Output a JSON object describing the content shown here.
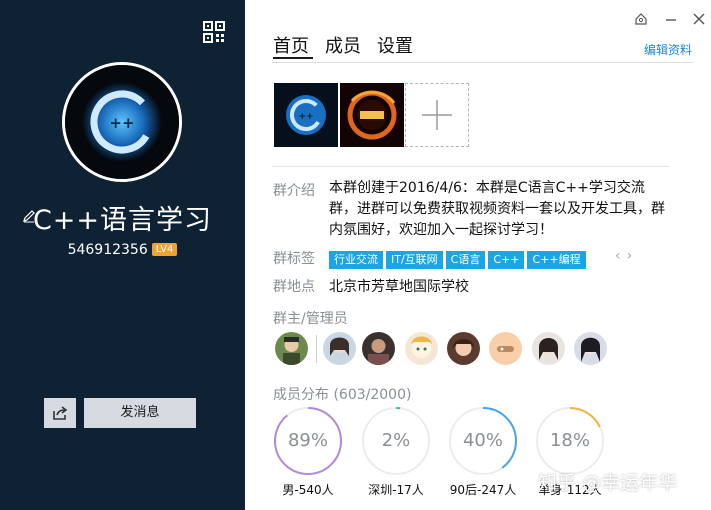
{
  "group": {
    "name": "C++语言学习",
    "id": "546912356",
    "level": "LV4"
  },
  "left_actions": {
    "send_label": "发消息"
  },
  "tabs": [
    {
      "label": "首页",
      "active": true
    },
    {
      "label": "成员",
      "active": false
    },
    {
      "label": "设置",
      "active": false
    }
  ],
  "edit_label": "编辑资料",
  "photos": [
    {
      "name": "cpp-logo-photo"
    },
    {
      "name": "fire-dragon-photo"
    }
  ],
  "intro": {
    "label": "群介绍",
    "text": "本群创建于2016/4/6：本群是C语言C++学习交流群，进群可以免费获取视频资料一套以及开发工具，群内氛围好，欢迎加入一起探讨学习！"
  },
  "tags": {
    "label": "群标签",
    "items": [
      "行业交流",
      "IT/互联网",
      "C语言",
      "C++",
      "C++编程"
    ]
  },
  "location": {
    "label": "群地点",
    "value": "北京市芳草地国际学校"
  },
  "admins": {
    "label": "群主/管理员",
    "count": 8
  },
  "distribution": {
    "label": "成员分布 (603/2000)",
    "items": [
      {
        "value": "89%",
        "caption": "男-540人",
        "fraction": 0.89,
        "color": "#b08ad8"
      },
      {
        "value": "2%",
        "caption": "深圳-17人",
        "fraction": 0.02,
        "color": "#3cc38a"
      },
      {
        "value": "40%",
        "caption": "90后-247人",
        "fraction": 0.4,
        "color": "#4aa3e8"
      },
      {
        "value": "18%",
        "caption": "单身-112人",
        "fraction": 0.18,
        "color": "#f2b24a"
      }
    ]
  },
  "watermark": "知乎 @幸运年华",
  "colors": {
    "left_panel": "#0f2233",
    "accent": "#1f86d6",
    "tag": "#1ba5e4",
    "level_badge": "#f0a232"
  }
}
